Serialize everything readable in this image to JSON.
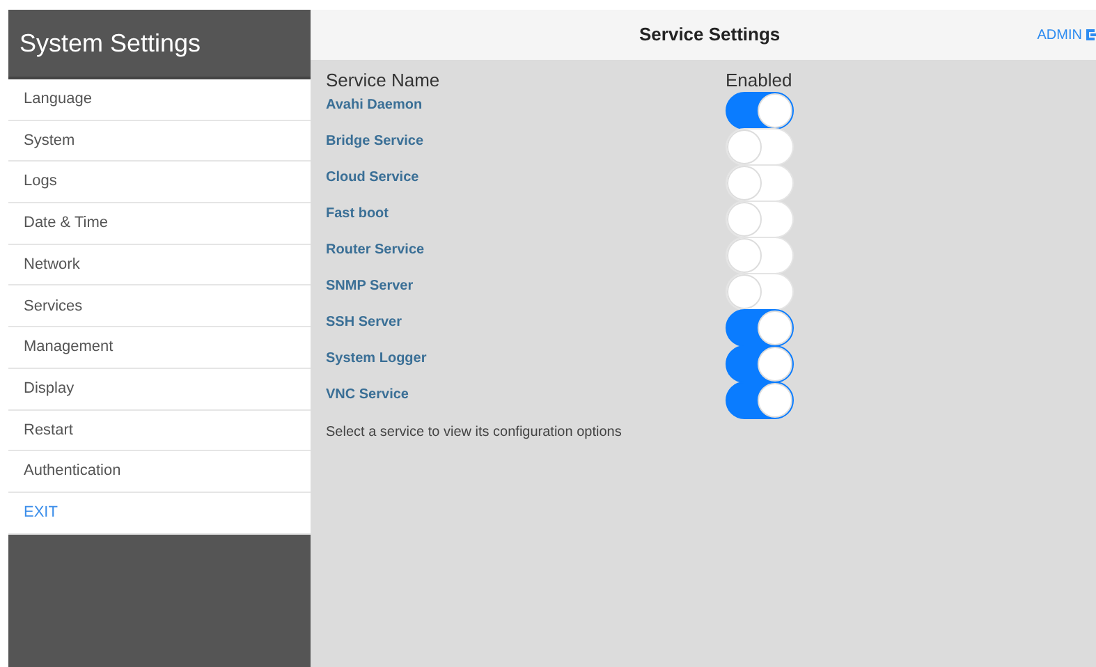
{
  "sidebar": {
    "title": "System Settings",
    "items": [
      {
        "label": "Language",
        "kind": "page"
      },
      {
        "label": "System",
        "kind": "page"
      },
      {
        "label": "Logs",
        "kind": "page"
      },
      {
        "label": "Date & Time",
        "kind": "page"
      },
      {
        "label": "Network",
        "kind": "page"
      },
      {
        "label": "Services",
        "kind": "page"
      },
      {
        "label": "Management",
        "kind": "page"
      },
      {
        "label": "Display",
        "kind": "page"
      },
      {
        "label": "Restart",
        "kind": "page"
      },
      {
        "label": "Authentication",
        "kind": "page"
      },
      {
        "label": "EXIT",
        "kind": "exit"
      }
    ]
  },
  "header": {
    "title": "Service Settings",
    "user": "ADMIN"
  },
  "table": {
    "columns": [
      "Service Name",
      "Enabled"
    ],
    "rows": [
      {
        "name": "Avahi Daemon",
        "on": true
      },
      {
        "name": "Bridge Service",
        "on": false
      },
      {
        "name": "Cloud Service",
        "on": false
      },
      {
        "name": "Fast boot",
        "on": false
      },
      {
        "name": "Router Service",
        "on": false
      },
      {
        "name": "SNMP Server",
        "on": false
      },
      {
        "name": "SSH Server",
        "on": true
      },
      {
        "name": "System Logger",
        "on": true
      },
      {
        "name": "VNC Service",
        "on": true
      }
    ]
  },
  "hint": "Select a service to view its configuration options"
}
